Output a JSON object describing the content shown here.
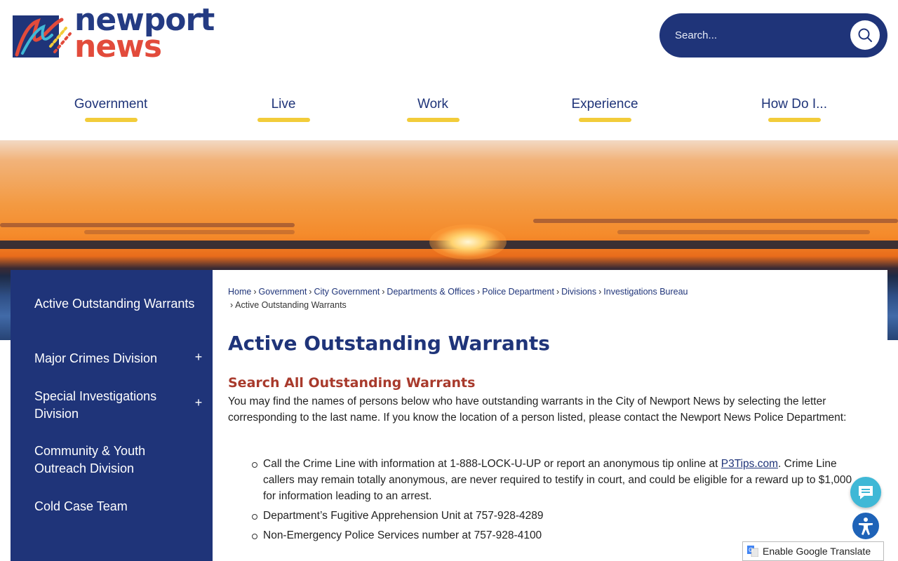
{
  "header": {
    "logo_line1": "newport",
    "logo_line2": "news",
    "search_placeholder": "Search..."
  },
  "nav": {
    "items": [
      {
        "label": "Government"
      },
      {
        "label": "Live"
      },
      {
        "label": "Work"
      },
      {
        "label": "Experience"
      },
      {
        "label": "How Do I..."
      }
    ]
  },
  "sidebar": {
    "items": [
      {
        "label": "Active Outstanding Warrants",
        "expand": ""
      },
      {
        "label": "Major Crimes Division",
        "expand": "+"
      },
      {
        "label": "Special Investigations Division",
        "expand": "+"
      },
      {
        "label": "Community & Youth Outreach Division",
        "expand": ""
      },
      {
        "label": "Cold Case Team",
        "expand": ""
      }
    ]
  },
  "breadcrumb": {
    "links": [
      "Home",
      "Government",
      "City Government",
      "Departments & Offices",
      "Police Department",
      "Divisions",
      "Investigations Bureau"
    ],
    "current": "Active Outstanding Warrants",
    "separator": "›"
  },
  "main": {
    "title": "Active Outstanding Warrants",
    "section_title": "Search All Outstanding Warrants",
    "intro": "You may find the names of persons below who have outstanding warrants in the City of Newport News by selecting the letter corresponding to the last name. If you know the location of a person listed, please contact the Newport News Police Department:",
    "bullet1_pre": "Call the Crime Line with information at 1-888-LOCK-U-UP or report an anonymous tip online at ",
    "bullet1_link": "P3Tips.com",
    "bullet1_post": ". Crime Line callers may remain totally anonymous, are never required to testify in court, and could be eligible for a reward up to $1,000 for information leading to an arrest.",
    "bullet2": "Department’s Fugitive Apprehension Unit at 757-928-4289",
    "bullet3": "Non-Emergency Police Services number at 757-928-4100"
  },
  "widgets": {
    "translate_label": "Enable Google Translate",
    "chat_icon": "chat-bubble-icon",
    "accessibility_icon": "accessibility-icon"
  },
  "colors": {
    "brand_blue": "#1f3479",
    "brand_red": "#e24b3b",
    "nav_underline": "#f2cc3a",
    "section_title": "#a83a2c"
  }
}
